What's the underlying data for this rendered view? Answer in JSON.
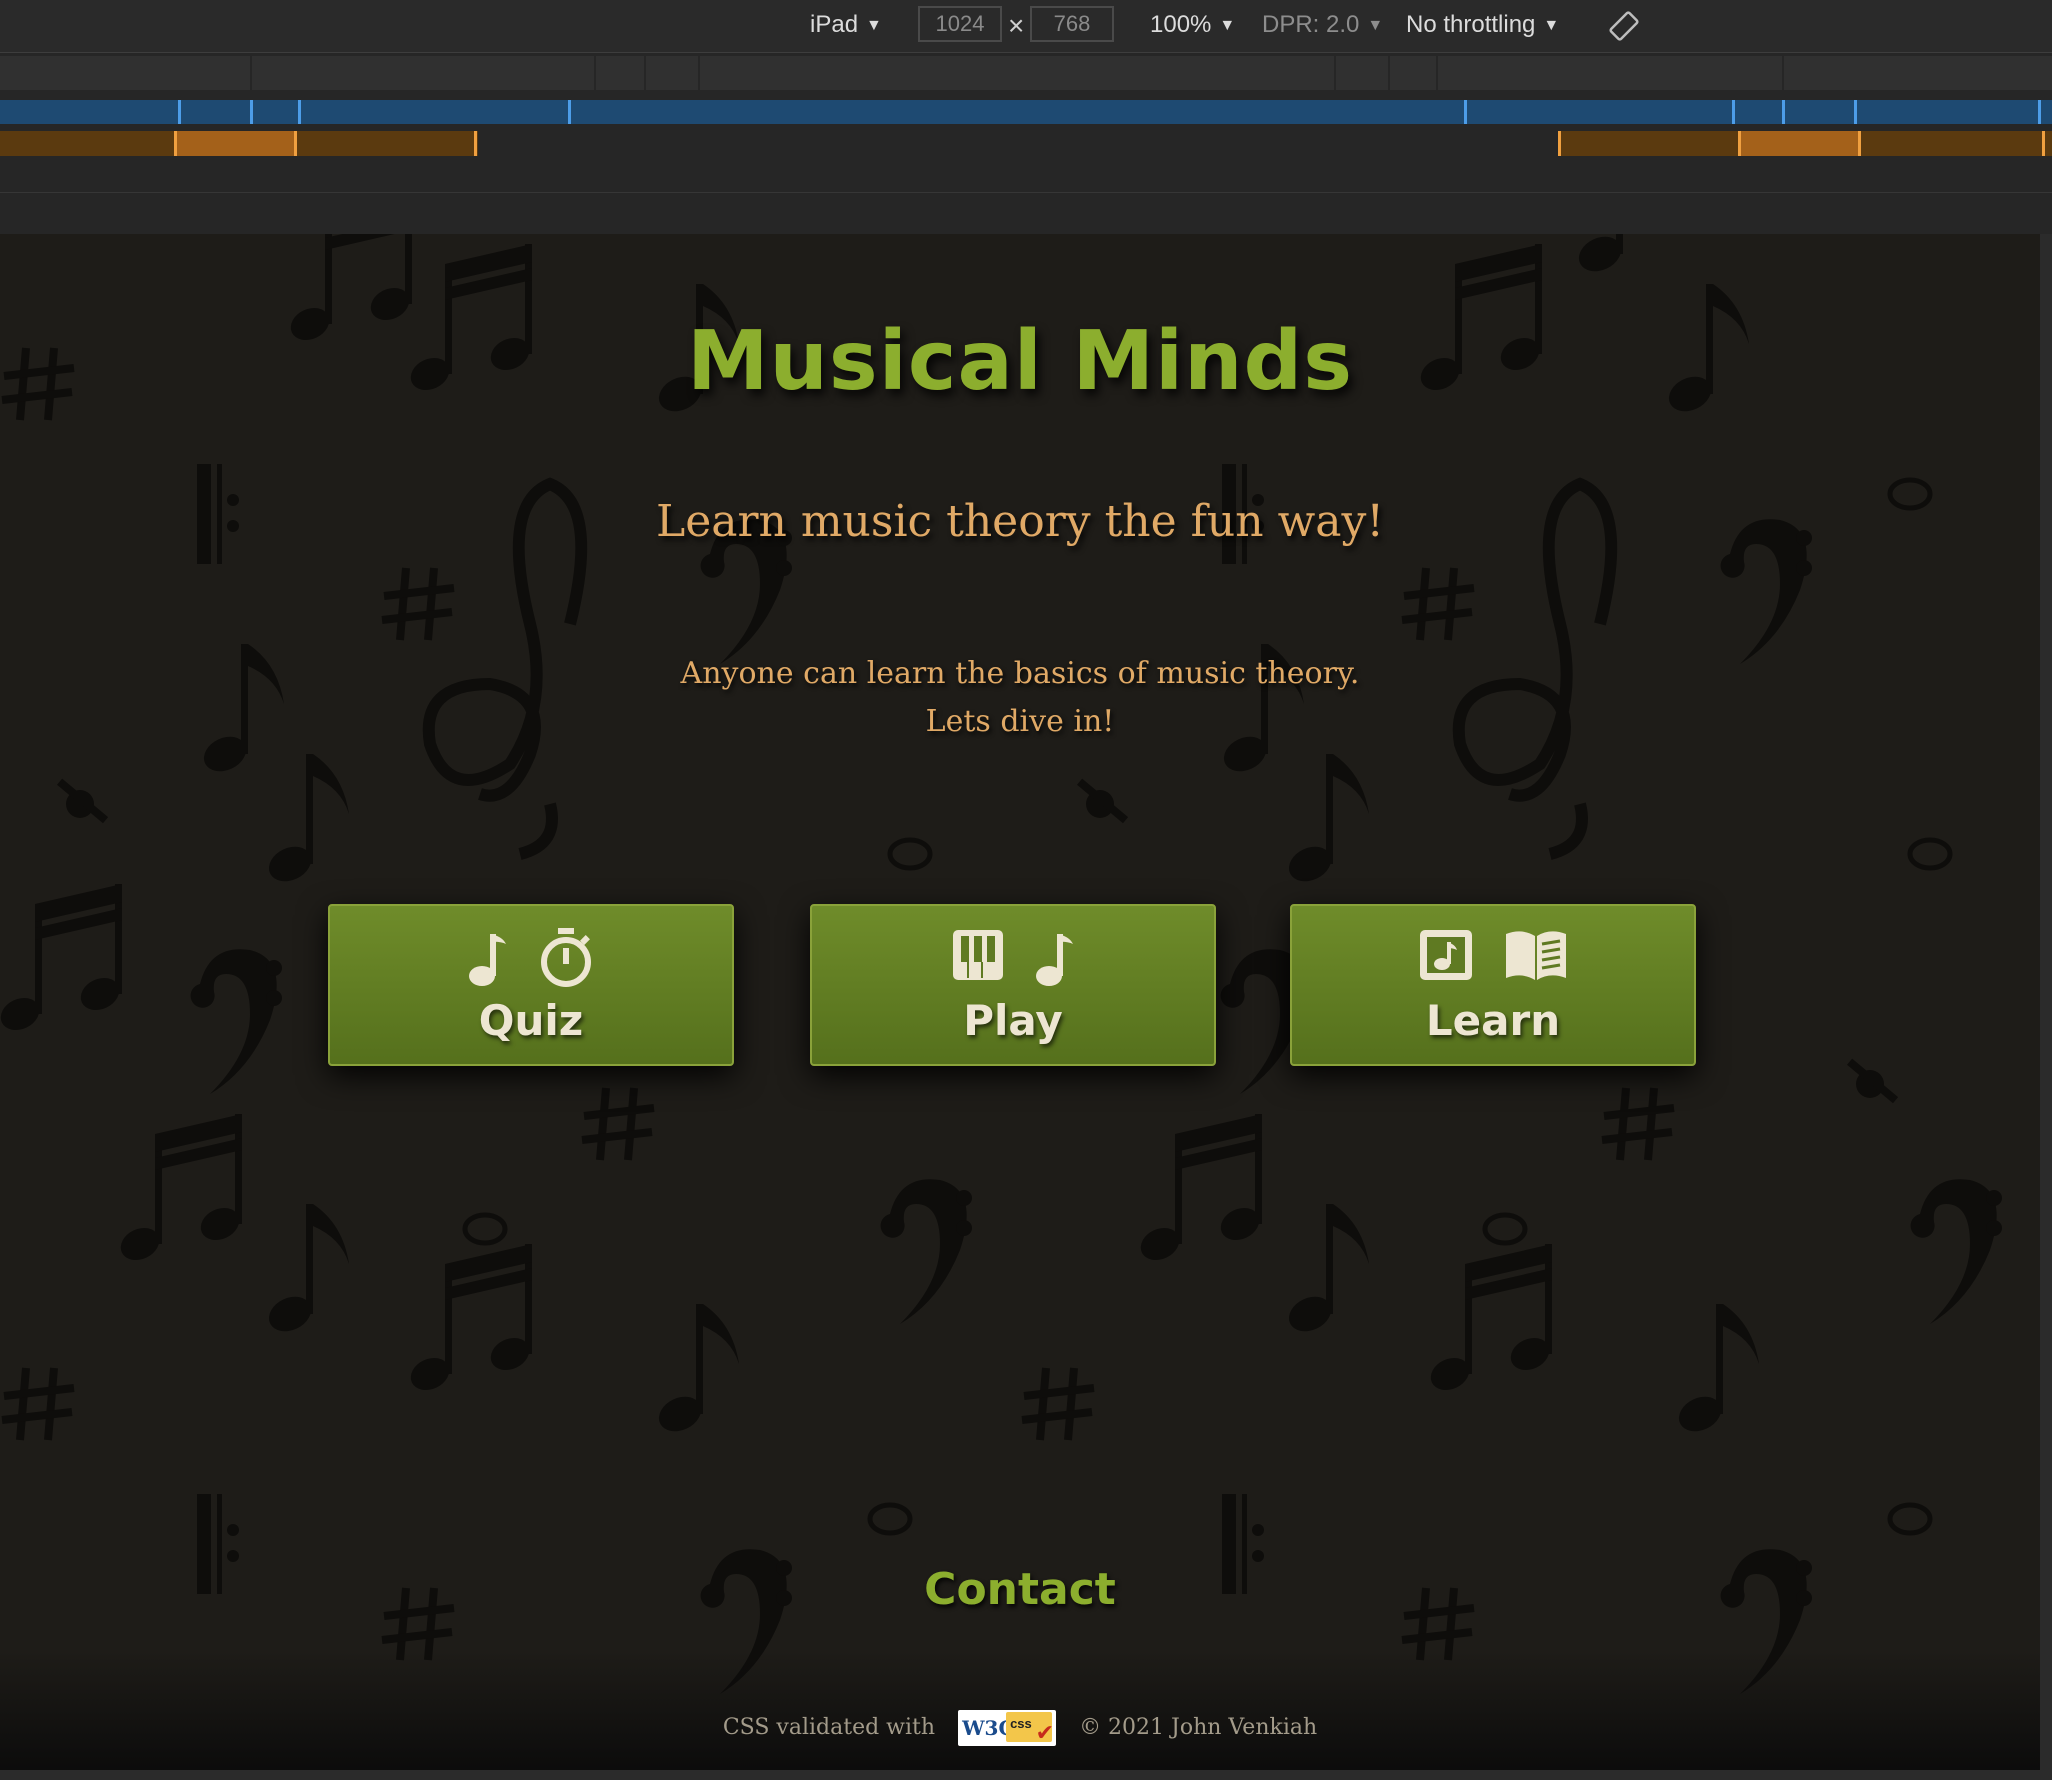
{
  "devtools": {
    "device": "iPad",
    "width": "1024",
    "height": "768",
    "zoom": "100%",
    "dpr": "DPR: 2.0",
    "throttling": "No throttling"
  },
  "site": {
    "title": "Musical Minds",
    "tagline": "Learn music theory the fun way!",
    "intro_line1": "Anyone can learn the basics of music theory.",
    "intro_line2": "Lets dive in!",
    "buttons": [
      {
        "label": "Quiz",
        "icons": [
          "music-note-icon",
          "stopwatch-icon"
        ]
      },
      {
        "label": "Play",
        "icons": [
          "piano-keys-icon",
          "music-note-icon"
        ]
      },
      {
        "label": "Learn",
        "icons": [
          "music-file-icon",
          "open-book-icon"
        ]
      }
    ],
    "contact": "Contact",
    "footer": {
      "validated": "CSS validated with",
      "badge": "W3C css",
      "copyright": "© 2021 John Venkiah"
    }
  },
  "colors": {
    "title_green": "#8cae2e",
    "tagline_orange": "#e0a966",
    "button_green": "#6f8c2a",
    "page_bg": "#1e1c18"
  }
}
